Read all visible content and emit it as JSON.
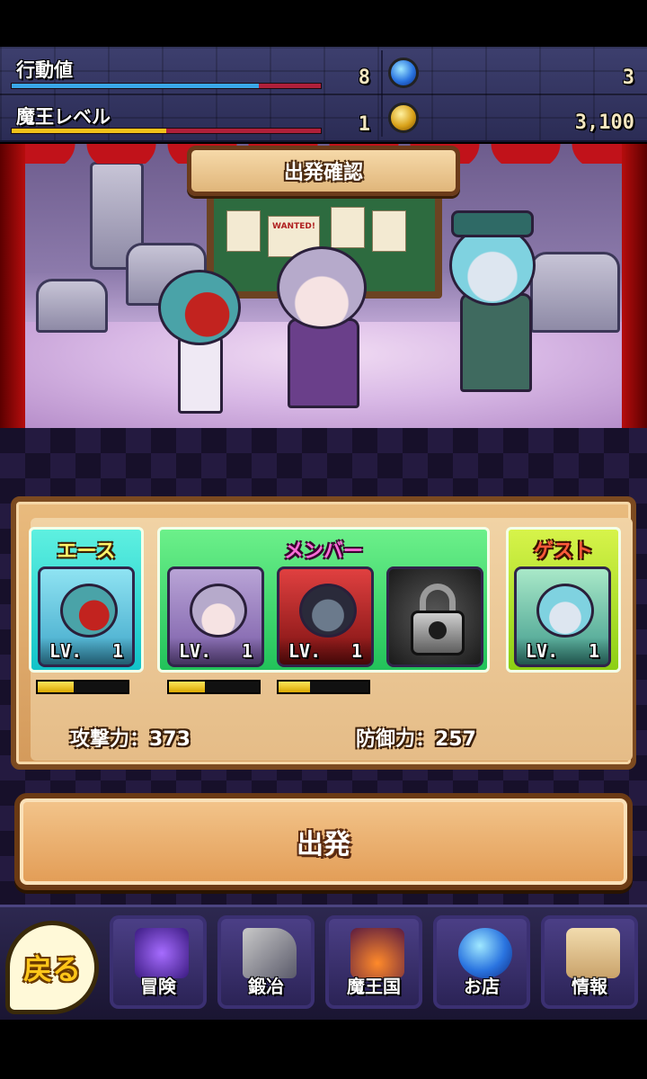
{
  "status": {
    "action_label": "行動値",
    "action_value": "8",
    "action_fill": 0.8,
    "level_label": "魔王レベル",
    "level_value": "1",
    "level_fill": 0.5,
    "gems": "3",
    "coins": "3,100"
  },
  "scene": {
    "title": "出発確認",
    "poster_text": "WANTED!"
  },
  "party": {
    "ace_label": "エース",
    "member_label": "メンバー",
    "guest_label": "ゲスト",
    "lv_prefix": "LV.",
    "slots": [
      {
        "level": "1",
        "hp_fill": 0.4
      },
      {
        "level": "1",
        "hp_fill": 0.4
      },
      {
        "level": "1",
        "hp_fill": 0.35
      },
      {
        "level": ""
      },
      {
        "level": "1"
      }
    ],
    "attack_text": "攻撃力：373",
    "defense_text": "防御力：257"
  },
  "depart_label": "出発",
  "nav": {
    "back": "戻る",
    "items": [
      "冒険",
      "鍛冶",
      "魔王国",
      "お店",
      "情報"
    ]
  },
  "colors": {
    "action_bar": "#3aa7e8",
    "level_bar": "#f2c21a",
    "accent_red": "#b0203a"
  }
}
